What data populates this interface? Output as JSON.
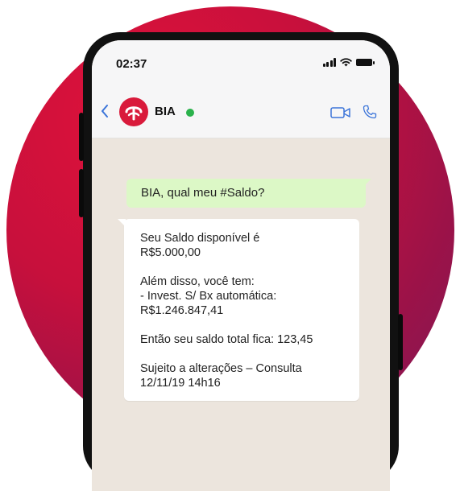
{
  "status_bar": {
    "time": "02:37",
    "icons": [
      "signal-icon",
      "wifi-icon",
      "battery-icon"
    ]
  },
  "header": {
    "back_icon": "chevron-left-icon",
    "contact_name": "BIA",
    "online_status_color": "#2bb24c",
    "video_icon": "video-camera-icon",
    "call_icon": "phone-icon"
  },
  "messages": {
    "outgoing": "BIA, qual meu #Saldo?",
    "incoming": {
      "line1": "Seu Saldo disponível é",
      "line2": "R$5.000,00",
      "line3": "Além disso, você tem:",
      "line4": "- Invest. S/ Bx automática:",
      "line5": "R$1.246.847,41",
      "line6": "Então seu saldo total fica: 123,45",
      "line7": "Sujeito a alterações – Consulta",
      "line8": "12/11/19 14h16"
    }
  },
  "colors": {
    "brand_red": "#d91a3b",
    "outgoing_bubble": "#dcf8c6",
    "chat_background": "#ece5dd",
    "accent_blue": "#3b74d9"
  }
}
